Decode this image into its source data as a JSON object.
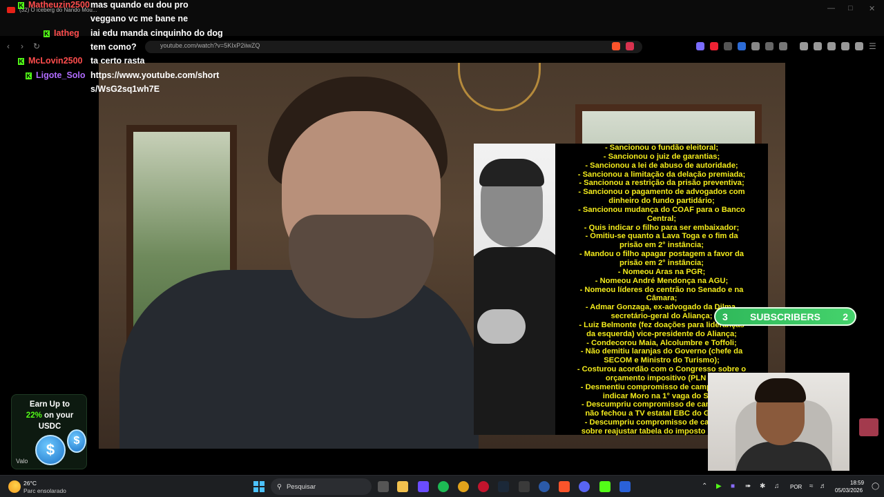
{
  "browser": {
    "tab_title": "(32) O iceberg do Nando Mou...",
    "url": "youtube.com/watch?v=5KIxP2iiwZQ"
  },
  "chat": [
    {
      "username": "Matheuzin2500",
      "message": "mas quando eu dou pro",
      "color": "#ff4d4d"
    },
    {
      "username": "",
      "message": "veggano vc me bane ne",
      "color": "#ff4d4d"
    },
    {
      "username": "Iatheg",
      "message": "iai edu manda cinquinho do dog",
      "color": "#ff4d4d"
    },
    {
      "username": "",
      "message": "tem como?",
      "color": "#ff4d4d"
    },
    {
      "username": "McLovin2500",
      "message": "ta certo rasta",
      "color": "#ff4d4d"
    },
    {
      "username": "Ligote_Solo",
      "message": "https://www.youtube.com/short",
      "color": "#b06cff"
    },
    {
      "username": "",
      "message": "s/WsG2sq1wh7E",
      "color": "#b06cff"
    }
  ],
  "overlay_list": [
    "- Sancionou o fundão eleitoral;",
    "- Sancionou o juiz de garantias;",
    "- Sancionou a lei de abuso de autoridade;",
    "- Sancionou a limitação da delação premiada;",
    "- Sancionou a restrição da prisão preventiva;",
    "- Sancionou o pagamento de advogados com",
    "dinheiro do fundo partidário;",
    "- Sancionou mudança do COAF para o Banco",
    "Central;",
    "- Quis indicar o filho para ser embaixador;",
    "- Omitiu-se quanto a Lava Toga e o fim da",
    "prisão em 2° instância;",
    "- Mandou o filho apagar postagem a favor da",
    "prisão em 2° instância;",
    "- Nomeou Aras na PGR;",
    "- Nomeou André Mendonça na AGU;",
    "- Nomeou líderes do centrão no Senado e na",
    "Câmara;",
    "- Admar Gonzaga, ex-advogado da Dilma,",
    "secretário-geral do Aliança;",
    "- Luiz Belmonte (fez doações para lideranças",
    "da esquerda) vice-presidente do Aliança;",
    "- Condecorou Maia, Alcolumbre e Toffoli;",
    "- Não demitiu laranjas do Governo (chefe da",
    "SECOM e Ministro do Turismo);",
    "- Costurou acordão com o Congresso sobre o",
    "orçamento impositivo (PLN 4);",
    "- Desmentiu compromisso de campanha em",
    "indicar Moro na 1° vaga do STF;",
    "- Descumpriu compromisso de campanha e",
    "não fechou a TV estatal EBC do Governo;",
    "- Descumpriu compromisso de campanha",
    "sobre reajustar tabela do imposto de renda."
  ],
  "subscribers": {
    "left_count": "3",
    "label": "SUBSCRIBERS",
    "right_count": "2"
  },
  "ad": {
    "line1": "Earn Up to",
    "percent": "22%",
    "line2": " on your",
    "line3": "USDC",
    "brand": "Valo"
  },
  "taskbar": {
    "temperature": "26°C",
    "weather": "Parc ensolarado",
    "search_placeholder": "Pesquisar",
    "language": "POR",
    "time": "18:59",
    "date": "05/03/2026"
  },
  "colors": {
    "kick_green": "#53fc18",
    "overlay_text": "#f4ec1c",
    "subs_green": "#2fb85a"
  }
}
